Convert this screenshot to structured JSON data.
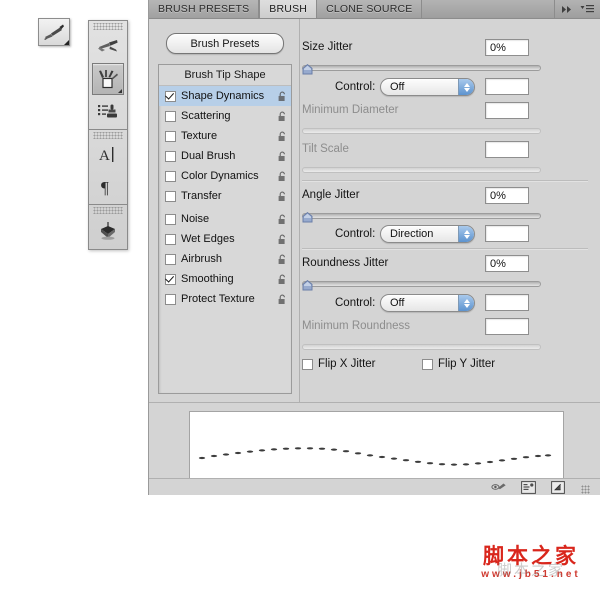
{
  "tool_swatch": {
    "icon": "brush-tool-icon"
  },
  "toolstrip": {
    "groups": [
      {
        "tools": [
          {
            "name": "mixer-brush-tool",
            "icon": "mixer-brush-icon",
            "selected": false
          },
          {
            "name": "brush-preset-picker-tool",
            "icon": "brush-jar-icon",
            "selected": true
          },
          {
            "name": "clone-stamp-tool",
            "icon": "clone-stamp-icon",
            "selected": false
          }
        ]
      },
      {
        "tools": [
          {
            "name": "type-tool",
            "icon": "type-tool-icon",
            "selected": false
          },
          {
            "name": "paragraph-tool",
            "icon": "paragraph-mark-icon",
            "selected": false
          }
        ]
      },
      {
        "tools": [
          {
            "name": "3d-tool",
            "icon": "three-d-object-icon",
            "selected": false
          }
        ]
      }
    ]
  },
  "panel": {
    "tabs": [
      {
        "label": "BRUSH PRESETS",
        "active": false
      },
      {
        "label": "BRUSH",
        "active": true
      },
      {
        "label": "CLONE SOURCE",
        "active": false
      }
    ],
    "tabbar_right": {
      "collapse_icon": "double-chevron-right-icon",
      "menu_icon": "panel-menu-icon"
    },
    "presets_button": "Brush Presets",
    "brush_list": {
      "header": "Brush Tip Shape",
      "items": [
        {
          "label": "Shape Dynamics",
          "checked": true,
          "selected": true,
          "lock": "lock-open-icon"
        },
        {
          "label": "Scattering",
          "checked": false,
          "selected": false,
          "lock": "lock-open-icon"
        },
        {
          "label": "Texture",
          "checked": false,
          "selected": false,
          "lock": "lock-open-icon"
        },
        {
          "label": "Dual Brush",
          "checked": false,
          "selected": false,
          "lock": "lock-open-icon"
        },
        {
          "label": "Color Dynamics",
          "checked": false,
          "selected": false,
          "lock": "lock-open-icon"
        },
        {
          "label": "Transfer",
          "checked": false,
          "selected": false,
          "lock": "lock-open-icon"
        },
        {
          "label": "Noise",
          "checked": false,
          "selected": false,
          "lock": "lock-open-icon",
          "gap": true
        },
        {
          "label": "Wet Edges",
          "checked": false,
          "selected": false,
          "lock": "lock-open-icon"
        },
        {
          "label": "Airbrush",
          "checked": false,
          "selected": false,
          "lock": "lock-open-icon"
        },
        {
          "label": "Smoothing",
          "checked": true,
          "selected": false,
          "lock": "lock-open-icon"
        },
        {
          "label": "Protect Texture",
          "checked": false,
          "selected": false,
          "lock": "lock-open-icon"
        }
      ]
    },
    "shape_dynamics": {
      "size_jitter": {
        "label": "Size Jitter",
        "value": "0%",
        "slider_pct": 0,
        "enabled": true,
        "control_label": "Control:",
        "control_value": "Off",
        "control_field_value": ""
      },
      "minimum_diameter": {
        "label": "Minimum Diameter",
        "value": "",
        "slider_pct": 0,
        "enabled": false
      },
      "tilt_scale": {
        "label": "Tilt Scale",
        "value": "",
        "slider_pct": 0,
        "enabled": false
      },
      "angle_jitter": {
        "label": "Angle Jitter",
        "value": "0%",
        "slider_pct": 0,
        "enabled": true,
        "control_label": "Control:",
        "control_value": "Direction",
        "control_field_value": ""
      },
      "roundness_jitter": {
        "label": "Roundness Jitter",
        "value": "0%",
        "slider_pct": 0,
        "enabled": true,
        "control_label": "Control:",
        "control_value": "Off",
        "control_field_value": ""
      },
      "minimum_roundness": {
        "label": "Minimum Roundness",
        "value": "",
        "slider_pct": 0,
        "enabled": false
      },
      "flip_x": {
        "label": "Flip X Jitter",
        "checked": false
      },
      "flip_y": {
        "label": "Flip Y Jitter",
        "checked": false
      }
    },
    "footer": {
      "icons": [
        {
          "name": "toggle-airbrush-icon"
        },
        {
          "name": "create-new-preset-icon"
        },
        {
          "name": "new-brush-icon"
        }
      ],
      "resize_grip": "resize-grip"
    }
  },
  "watermark": {
    "cn": "脚本之家",
    "url": "www.jb51.net",
    "ghost": "脚本之家"
  },
  "colors": {
    "panel_bg": "#d4d4d4",
    "tabbar_bg": "#a8a8a8",
    "tab_active_bg": "#d6d6d6",
    "selection_blue": "#b7cfe8",
    "dropdown_arrow_blue": "#5d93cf",
    "slider_thumb_blue": "#93a8cf",
    "watermark_red": "#d9261c"
  }
}
